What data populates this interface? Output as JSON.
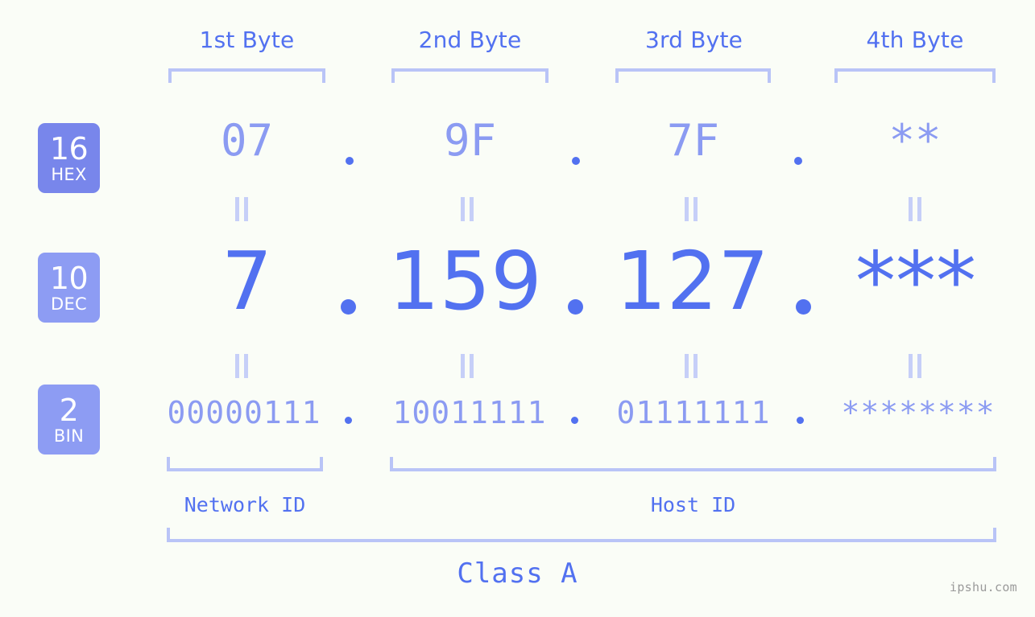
{
  "meta": {
    "background_color": "#fafdf7",
    "accent_strong": "#5271f0",
    "accent_light": "#8b9bf2",
    "bracket_color": "#b9c4f7",
    "badge_hex_color": "#7886eb",
    "badge_dec_color": "#8d9cf3",
    "watermark": "ipshu.com"
  },
  "byte_headers": [
    {
      "label": "1st Byte"
    },
    {
      "label": "2nd Byte"
    },
    {
      "label": "3rd Byte"
    },
    {
      "label": "4th Byte"
    }
  ],
  "bases": [
    {
      "num": "16",
      "name": "HEX"
    },
    {
      "num": "10",
      "name": "DEC"
    },
    {
      "num": "2",
      "name": "BIN"
    }
  ],
  "rows": {
    "hex": {
      "values": [
        "07",
        "9F",
        "7F",
        "**"
      ],
      "separator": "."
    },
    "dec": {
      "values": [
        "7",
        "159",
        "127",
        "***"
      ],
      "separator": "."
    },
    "bin": {
      "values": [
        "00000111",
        "10011111",
        "01111111",
        "********"
      ],
      "separator": "."
    }
  },
  "equality_marks": {
    "glyph": "||",
    "count_per_row": 4
  },
  "segments": [
    {
      "label": "Network ID"
    },
    {
      "label": "Host ID"
    }
  ],
  "class": {
    "label": "Class A"
  },
  "ip_address": "7.159.127.***"
}
